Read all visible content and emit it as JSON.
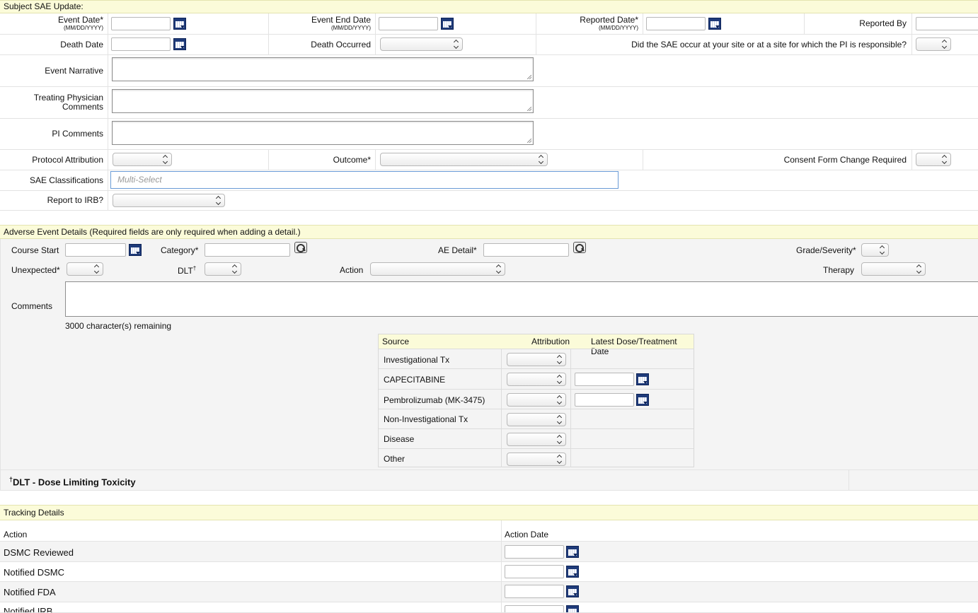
{
  "sae": {
    "header": "Subject SAE Update:",
    "event_date_label": "Event Date*",
    "event_date_hint": "(MM/DD/YYYY)",
    "event_end_label": "Event End Date",
    "event_end_hint": "(MM/DD/YYYY)",
    "reported_date_label": "Reported Date*",
    "reported_date_hint": "(MM/DD/YYYY)",
    "reported_by_label": "Reported By",
    "death_date_label": "Death Date",
    "death_occurred_label": "Death Occurred",
    "site_question": "Did the SAE occur at your site or at a site for which the PI is responsible?",
    "event_narrative_label": "Event Narrative",
    "physician_comments_label": "Treating Physician Comments",
    "pi_comments_label": "PI Comments",
    "protocol_attribution_label": "Protocol Attribution",
    "outcome_label": "Outcome*",
    "consent_change_label": "Consent Form Change Required",
    "classifications_label": "SAE Classifications",
    "classifications_placeholder": "Multi-Select",
    "report_irb_label": "Report to IRB?"
  },
  "ae": {
    "header": "Adverse Event Details (Required fields are only required when adding a detail.)",
    "course_start_label": "Course Start",
    "category_label": "Category*",
    "ae_detail_label": "AE Detail*",
    "grade_label": "Grade/Severity*",
    "unexpected_label": "Unexpected*",
    "dlt_label": "DLT",
    "dlt_mark": "†",
    "action_label": "Action",
    "therapy_label": "Therapy",
    "comments_label": "Comments",
    "remaining": "3000 character(s) remaining",
    "source_header": "Source",
    "attribution_header": "Attribution",
    "dose_header": "Latest Dose/Treatment Date",
    "sources": [
      {
        "name": "Investigational Tx"
      },
      {
        "name": "CAPECITABINE"
      },
      {
        "name": "Pembrolizumab (MK-3475)"
      },
      {
        "name": "Non-Investigational Tx"
      },
      {
        "name": "Disease"
      },
      {
        "name": "Other"
      }
    ],
    "footnote_mark": "†",
    "footnote": "DLT - Dose Limiting Toxicity"
  },
  "tracking": {
    "header": "Tracking Details",
    "action_header": "Action",
    "date_header": "Action Date",
    "rows": [
      {
        "label": "DSMC Reviewed"
      },
      {
        "label": "Notified DSMC"
      },
      {
        "label": "Notified FDA"
      },
      {
        "label": "Notified IRB"
      }
    ]
  }
}
